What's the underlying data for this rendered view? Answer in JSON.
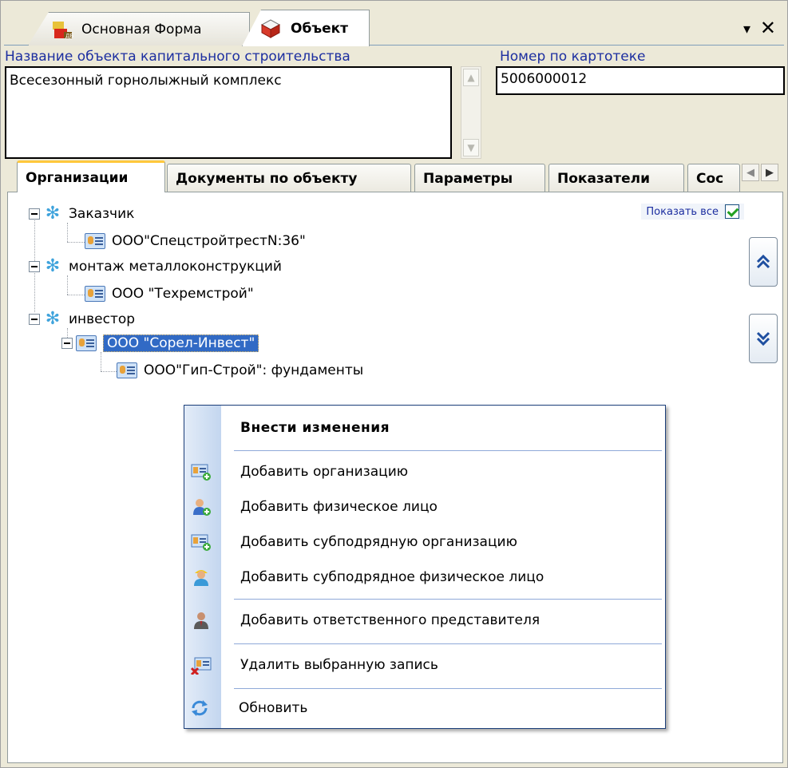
{
  "doc_tabs": [
    {
      "label": "Основная Форма"
    },
    {
      "label": "Объект"
    }
  ],
  "window_controls": {
    "dropdown": "▾",
    "close": "✕"
  },
  "fields": {
    "name_label": "Название объекта капитального строительства",
    "name_value": "Всесезонный горнолыжный комплекс",
    "number_label": "Номер по картотеке",
    "number_value": "5006000012"
  },
  "inner_tabs": [
    {
      "label": "Организации"
    },
    {
      "label": "Документы по объекту"
    },
    {
      "label": "Параметры"
    },
    {
      "label": "Показатели"
    },
    {
      "label": "Сос"
    }
  ],
  "show_all": {
    "label": "Показать все",
    "checked": true
  },
  "tree": {
    "roles": [
      {
        "label": "Заказчик",
        "orgs": [
          {
            "label": "ООО\"СпецстройтрестN:36\""
          }
        ]
      },
      {
        "label": "монтаж металлоконструкций",
        "orgs": [
          {
            "label": "ООО \"Техремстрой\""
          }
        ]
      },
      {
        "label": "инвестор",
        "orgs": [
          {
            "label": "ООО \"Сорел-Инвест\"",
            "selected": true,
            "children": [
              {
                "label": "ООО\"Гип-Строй\":  фундаменты"
              }
            ]
          }
        ]
      }
    ]
  },
  "context_menu": {
    "title": "Внести изменения",
    "items": [
      {
        "label": "Добавить организацию",
        "icon": "add-organization-icon"
      },
      {
        "label": "Добавить физическое лицо",
        "icon": "add-person-icon"
      },
      {
        "label": "Добавить субподрядную организацию",
        "icon": "add-suborganization-icon"
      },
      {
        "label": "Добавить субподрядное физическое лицо",
        "icon": "add-subperson-icon"
      },
      {
        "label": "Добавить ответственного представителя",
        "icon": "add-representative-icon"
      },
      {
        "label": "Удалить выбранную запись",
        "icon": "delete-record-icon"
      },
      {
        "label": "Обновить",
        "icon": "refresh-icon"
      }
    ]
  },
  "colors": {
    "accent": "#316ac5",
    "label_blue": "#1c2ea0",
    "tab_highlight": "#ffc83c",
    "menu_border": "#1c3f7a"
  }
}
